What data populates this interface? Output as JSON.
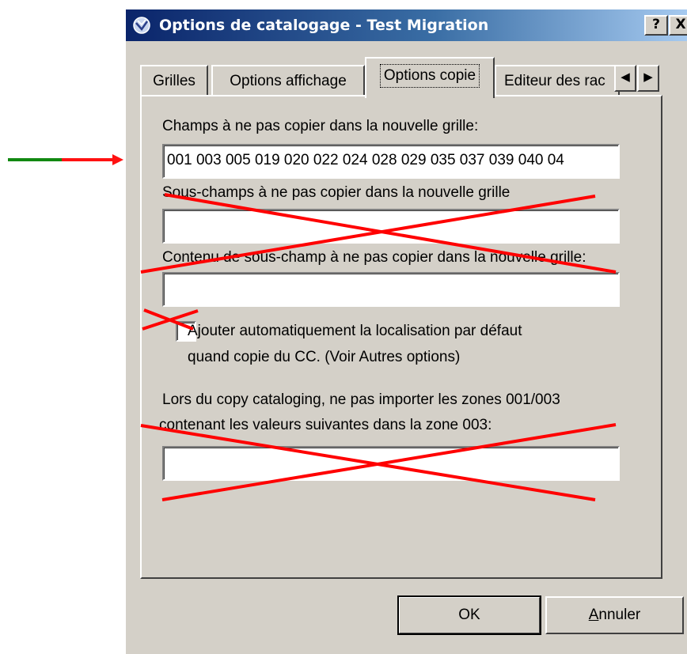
{
  "window": {
    "title": "Options de catalogage - Test Migration",
    "help_label": "?",
    "close_label": "X"
  },
  "tabs": [
    {
      "label": "Grilles"
    },
    {
      "label": "Options affichage"
    },
    {
      "label": "Options copie"
    },
    {
      "label": "Editeur des rac"
    }
  ],
  "tab_scroll": {
    "left": "◀",
    "right": "▶"
  },
  "panel": {
    "fields_label": "Champs à ne pas copier dans la nouvelle grille:",
    "fields_value": "001 003 005 019 020 022 024 028 029 035 037 039 040 04",
    "subfields_label": "Sous-champs à ne pas copier dans la nouvelle grille",
    "subfields_value": "",
    "content_label": "Contenu de sous-champ à ne pas copier dans la nouvelle grille:",
    "content_value": "",
    "checkbox_label_line1": "Ajouter automatiquement la localisation par défaut",
    "checkbox_label_line2": "quand copie du CC. (Voir Autres options)",
    "copycat_label_line1": "Lors du copy cataloging, ne pas importer les zones 001/003",
    "copycat_label_line2": "contenant les valeurs suivantes dans la zone 003:",
    "copycat_value": ""
  },
  "buttons": {
    "ok": "OK",
    "cancel_first": "A",
    "cancel_rest": "nnuler"
  },
  "annotations": {
    "arrow_color_start": "#118811",
    "arrow_color_end": "#ff1111",
    "cross_color": "#ff0000"
  }
}
